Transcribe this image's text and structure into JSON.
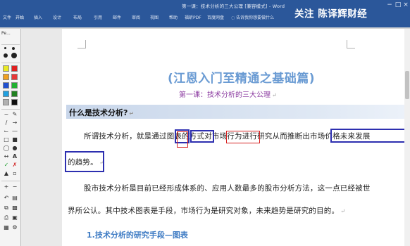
{
  "window": {
    "title": "第一课：技术分析的三大公理 [兼容模式] - Word",
    "watermark": "关注 陈译辉财经",
    "controls": [
      "−",
      "□",
      "×"
    ]
  },
  "ribbon": {
    "tabs": [
      "文件",
      "开始",
      "插入",
      "设计",
      "布局",
      "引用",
      "邮件",
      "审阅",
      "视图",
      "帮助",
      "福昕PDF",
      "百度网盘"
    ],
    "tell_me": "告诉我你想要做什么"
  },
  "document": {
    "title": "(江恩入门至精通之基础篇)",
    "subtitle": "第一课：技术分析的三大公理",
    "heading": "什么是技术分析?",
    "para1_line1": "所谓技术分析，就是通过图表的方式对市场行为进行研究从而推断出市场价格未来发展",
    "para1_line2": "的趋势。",
    "para2_line1": "股市技术分析是目前已经形成体系的、应用人数最多的股市分析方法，这一点已经被世",
    "para2_line2": "界所公认。其中技术图表是手段，市场行为是研究对象，未来趋势是研究的目的。",
    "section1": "1.技术分析的研究手段—图表",
    "para_mark": "↵"
  },
  "toolbox": {
    "title": "Pe...",
    "colors": [
      "#e8e825",
      "#e02020",
      "#f0a020",
      "#e83838",
      "#2050d0",
      "#20b030",
      "#20a0e0",
      "#208020",
      "#b0b0b0",
      "#101010"
    ],
    "tools": [
      "pen-tool",
      "line-tool",
      "arrow-tool",
      "rectangle-tool",
      "ellipse-tool",
      "text-tool",
      "check-tool",
      "eraser-tool",
      "undo-tool",
      "clear-tool",
      "save-tool",
      "copy-tool",
      "close-tool"
    ]
  }
}
